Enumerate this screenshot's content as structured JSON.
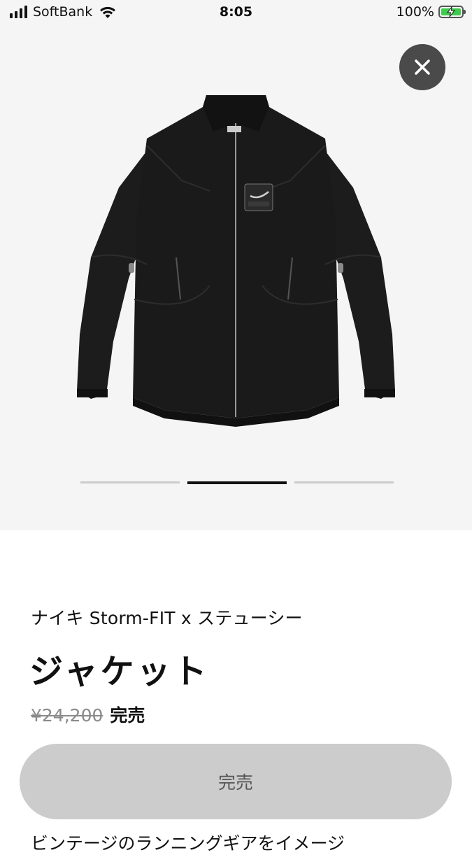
{
  "status_bar": {
    "carrier": "SoftBank",
    "time": "8:05",
    "battery": "100%"
  },
  "carousel": {
    "active_index": 1,
    "total": 3,
    "image": "black-jacket-image"
  },
  "product": {
    "subtitle": "ナイキ Storm-FIT x ステューシー",
    "title": "ジャケット",
    "original_price": "¥24,200",
    "sold_label": "完売",
    "button_label": "完売",
    "description_preview": "ビンテージのランニングギアをイメージ"
  },
  "colors": {
    "hero_bg": "#f5f5f5",
    "button_bg": "#cccccc",
    "close_bg": "#4a4a4a"
  }
}
